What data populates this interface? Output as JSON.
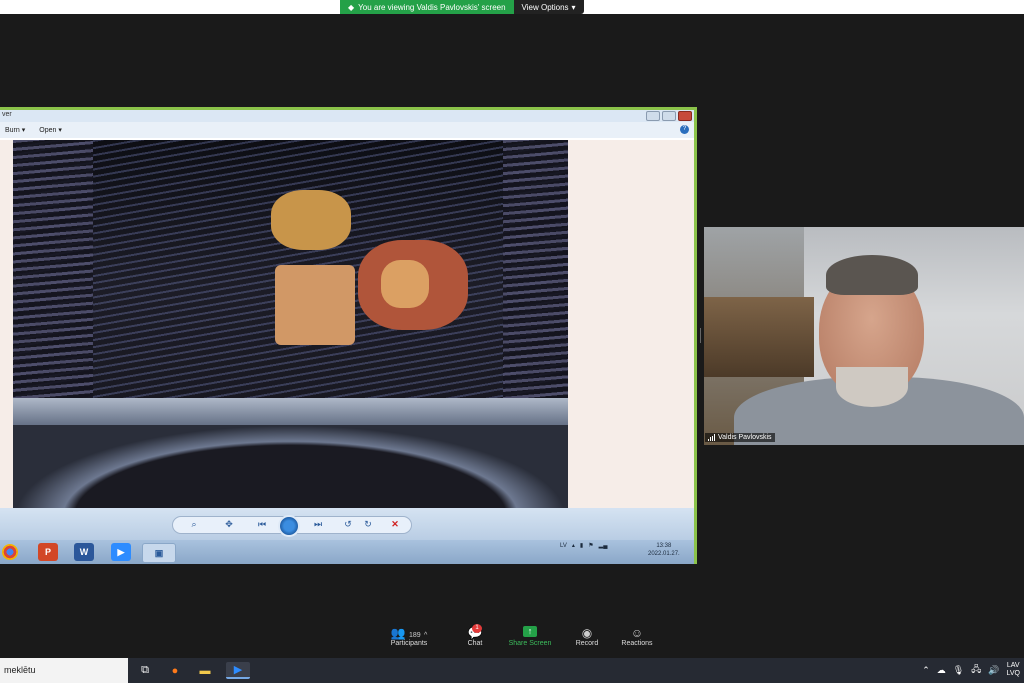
{
  "banner": {
    "viewing_text": "You are viewing Valdis Pavlovskis' screen",
    "view_options_label": "View Options"
  },
  "photo_viewer": {
    "title_fragment": "ver",
    "menu": [
      "Burn",
      "Open"
    ],
    "help_label": "?",
    "controls": [
      "zoom-icon",
      "fit-icon",
      "previous-icon",
      "slideshow-icon",
      "next-icon",
      "rotate-left-icon",
      "rotate-right-icon",
      "delete-icon"
    ]
  },
  "inner_taskbar": {
    "apps": [
      "chrome-icon",
      "powerpoint-icon",
      "word-icon",
      "zoom-icon",
      "photo-viewer-icon"
    ],
    "tray_lang": "LV",
    "clock_time": "13:38",
    "clock_date": "2022.01.27."
  },
  "participant_video": {
    "name": "Valdis Pavlovskis"
  },
  "zoom_toolbar": {
    "participants_label": "Participants",
    "participants_count": "189",
    "chat_label": "Chat",
    "chat_badge": "1",
    "share_label": "Share Screen",
    "record_label": "Record",
    "reactions_label": "Reactions"
  },
  "windows_taskbar": {
    "search_text": "meklētu",
    "lang_top": "LAV",
    "lang_bottom": "LVQ"
  },
  "colors": {
    "zoom_green": "#24a148",
    "share_border": "#8bc34a",
    "badge_red": "#e23a3a"
  }
}
